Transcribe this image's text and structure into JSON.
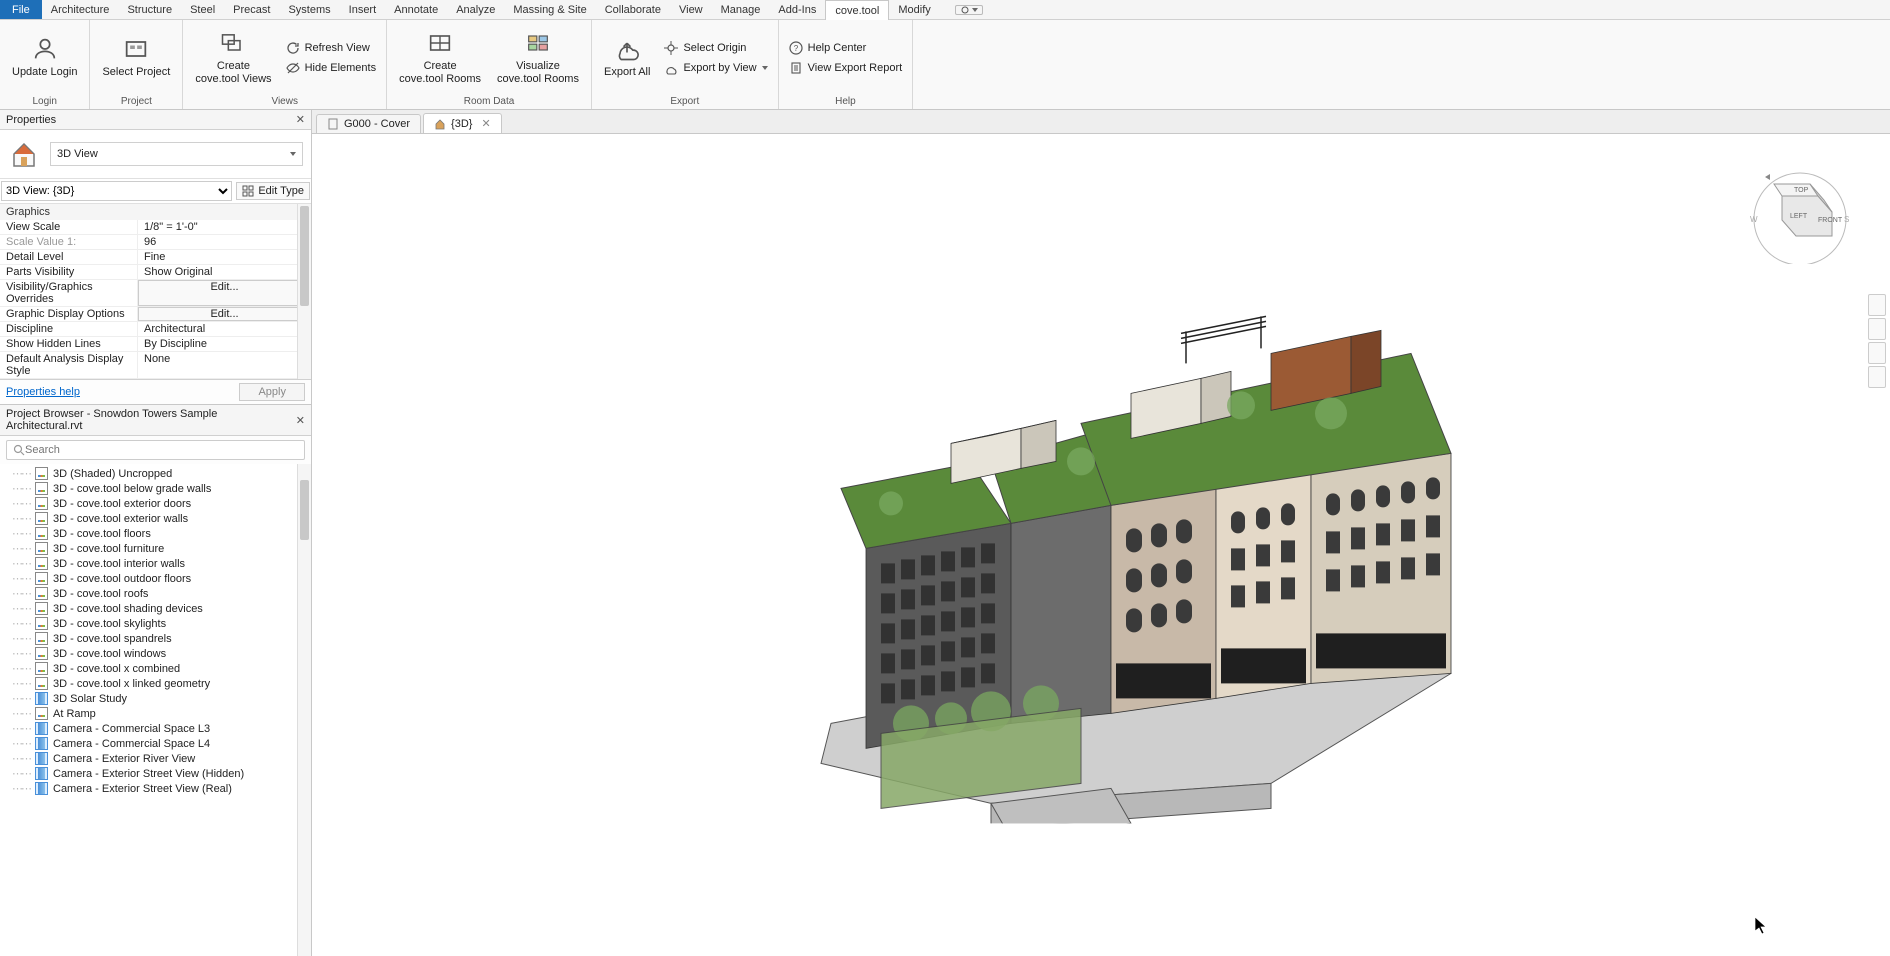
{
  "menu": {
    "file": "File",
    "items": [
      "Architecture",
      "Structure",
      "Steel",
      "Precast",
      "Systems",
      "Insert",
      "Annotate",
      "Analyze",
      "Massing & Site",
      "Collaborate",
      "View",
      "Manage",
      "Add-Ins",
      "cove.tool",
      "Modify"
    ],
    "active": "cove.tool"
  },
  "ribbon": {
    "groups": [
      {
        "label": "Login",
        "buttons": [
          {
            "text": "Update Login",
            "icon": "login"
          }
        ]
      },
      {
        "label": "Project",
        "buttons": [
          {
            "text": "Select Project",
            "icon": "project"
          }
        ]
      },
      {
        "label": "Views",
        "buttons": [
          {
            "text": "Create\ncove.tool Views",
            "icon": "create-views"
          }
        ],
        "side": [
          {
            "text": "Refresh View",
            "icon": "refresh"
          },
          {
            "text": "Hide Elements",
            "icon": "hide"
          }
        ]
      },
      {
        "label": "Room Data",
        "buttons": [
          {
            "text": "Create\ncove.tool Rooms",
            "icon": "create-rooms"
          },
          {
            "text": "Visualize\ncove.tool Rooms",
            "icon": "viz-rooms"
          }
        ]
      },
      {
        "label": "Export",
        "buttons": [
          {
            "text": "Export All",
            "icon": "export"
          }
        ],
        "side": [
          {
            "text": "Select Origin",
            "icon": "origin"
          },
          {
            "text": "Export by View",
            "icon": "export-view",
            "dropdown": true
          }
        ]
      },
      {
        "label": "Help",
        "side": [
          {
            "text": "Help Center",
            "icon": "help"
          },
          {
            "text": "View Export Report",
            "icon": "report"
          }
        ]
      }
    ]
  },
  "properties": {
    "title": "Properties",
    "type_selector": "3D View",
    "instance_label": "3D View: {3D}",
    "edit_type": "Edit Type",
    "section": "Graphics",
    "rows": [
      {
        "key": "View Scale",
        "val": "1/8\" = 1'-0\""
      },
      {
        "key": "Scale Value    1:",
        "val": "96",
        "disabled": true
      },
      {
        "key": "Detail Level",
        "val": "Fine"
      },
      {
        "key": "Parts Visibility",
        "val": "Show Original"
      },
      {
        "key": "Visibility/Graphics Overrides",
        "button": "Edit..."
      },
      {
        "key": "Graphic Display Options",
        "button": "Edit..."
      },
      {
        "key": "Discipline",
        "val": "Architectural"
      },
      {
        "key": "Show Hidden Lines",
        "val": "By Discipline"
      },
      {
        "key": "Default Analysis Display Style",
        "val": "None"
      }
    ],
    "help_link": "Properties help",
    "apply": "Apply"
  },
  "browser": {
    "title": "Project Browser - Snowdon Towers Sample Architectural.rvt",
    "search_placeholder": "Search",
    "items": [
      "3D (Shaded) Uncropped",
      "3D - cove.tool below grade walls",
      "3D - cove.tool exterior doors",
      "3D - cove.tool exterior walls",
      "3D - cove.tool floors",
      "3D - cove.tool furniture",
      "3D - cove.tool interior walls",
      "3D - cove.tool outdoor floors",
      "3D - cove.tool roofs",
      "3D - cove.tool shading devices",
      "3D - cove.tool skylights",
      "3D - cove.tool spandrels",
      "3D - cove.tool windows",
      "3D - cove.tool x combined",
      "3D - cove.tool x linked geometry",
      "3D Solar Study",
      "At Ramp",
      "Camera - Commercial Space L3",
      "Camera - Commercial Space L4",
      "Camera - Exterior River View",
      "Camera - Exterior Street View (Hidden)",
      "Camera - Exterior Street View (Real)"
    ],
    "blue_items": [
      "3D Solar Study",
      "Camera - Commercial Space L3",
      "Camera - Commercial Space L4",
      "Camera - Exterior River View",
      "Camera - Exterior Street View (Hidden)",
      "Camera - Exterior Street View (Real)"
    ]
  },
  "viewport": {
    "tabs": [
      {
        "label": "G000 - Cover",
        "icon": "sheet",
        "active": false,
        "closable": false
      },
      {
        "label": "{3D}",
        "icon": "home",
        "active": true,
        "closable": true
      }
    ],
    "viewcube": {
      "top": "TOP",
      "left": "LEFT",
      "front": "FRONT"
    }
  }
}
